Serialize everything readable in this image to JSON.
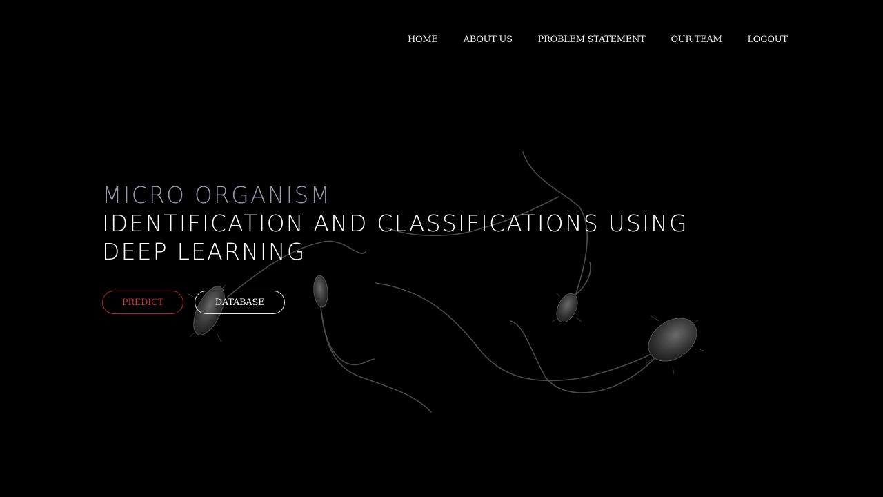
{
  "nav": {
    "items": [
      {
        "label": "HOME"
      },
      {
        "label": "ABOUT US"
      },
      {
        "label": "PROBLEM STATEMENT"
      },
      {
        "label": "OUR TEAM"
      },
      {
        "label": "LOGOUT"
      }
    ]
  },
  "hero": {
    "kicker": "MICRO ORGANISM",
    "title_line1": "IDENTIFICATION AND CLASSIFICATIONS USING",
    "title_line2": "DEEP LEARNING"
  },
  "buttons": {
    "predict_label": "PREDICT",
    "database_label": "DATABASE"
  },
  "colors": {
    "background": "#000000",
    "accent": "#b3262e",
    "kicker": "#9a9aae",
    "text": "#ffffff"
  }
}
